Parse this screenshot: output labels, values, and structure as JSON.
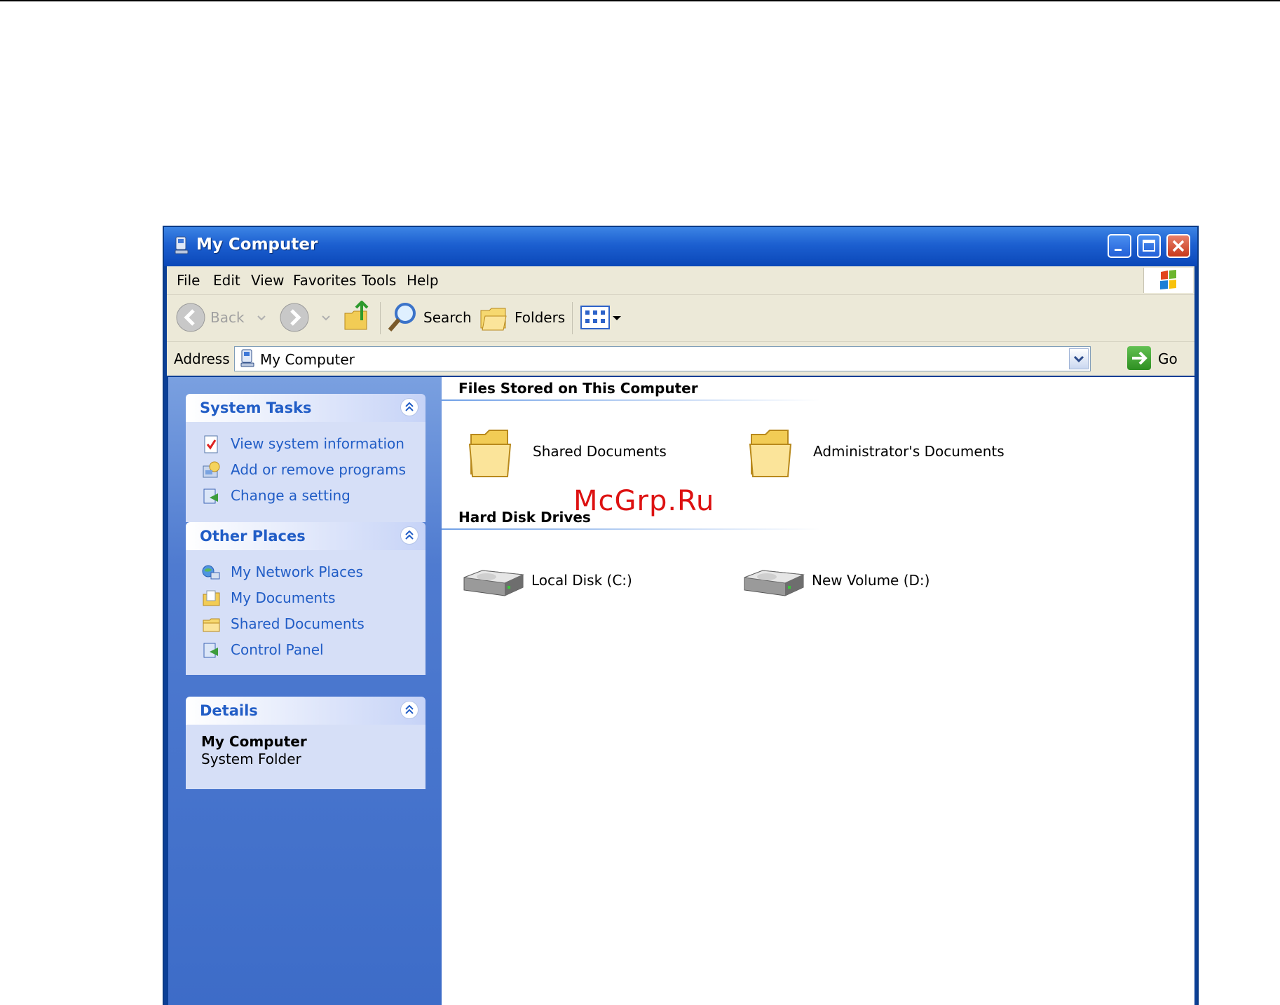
{
  "window": {
    "title": "My Computer"
  },
  "menu": [
    "File",
    "Edit",
    "View",
    "Favorites",
    "Tools",
    "Help"
  ],
  "toolbar": {
    "back_label": "Back",
    "search_label": "Search",
    "folders_label": "Folders"
  },
  "address": {
    "label": "Address",
    "value": "My Computer",
    "go_label": "Go"
  },
  "tasks": {
    "system": {
      "title": "System Tasks",
      "items": [
        "View system information",
        "Add or remove programs",
        "Change a setting"
      ]
    },
    "other": {
      "title": "Other Places",
      "items": [
        "My Network Places",
        "My Documents",
        "Shared Documents",
        "Control Panel"
      ]
    },
    "details": {
      "title": "Details",
      "name": "My Computer",
      "type": "System Folder"
    }
  },
  "content": {
    "files_group": {
      "title": "Files Stored on This Computer",
      "items": [
        "Shared Documents",
        "Administrator's Documents"
      ]
    },
    "drives_group": {
      "title": "Hard Disk Drives",
      "items": [
        "Local Disk (C:)",
        "New Volume (D:)"
      ]
    }
  },
  "watermark": "McGrp.Ru",
  "colors": {
    "title_bar": "#0a47b8",
    "task_pane": "#3d6cc8",
    "link": "#215dc6",
    "watermark": "#dd1111"
  },
  "icons": {
    "back": "back-arrow-icon",
    "forward": "forward-arrow-icon",
    "up": "up-folder-icon",
    "search": "magnifier-icon",
    "folders": "folders-icon",
    "views": "views-icon",
    "go": "go-arrow-icon"
  }
}
